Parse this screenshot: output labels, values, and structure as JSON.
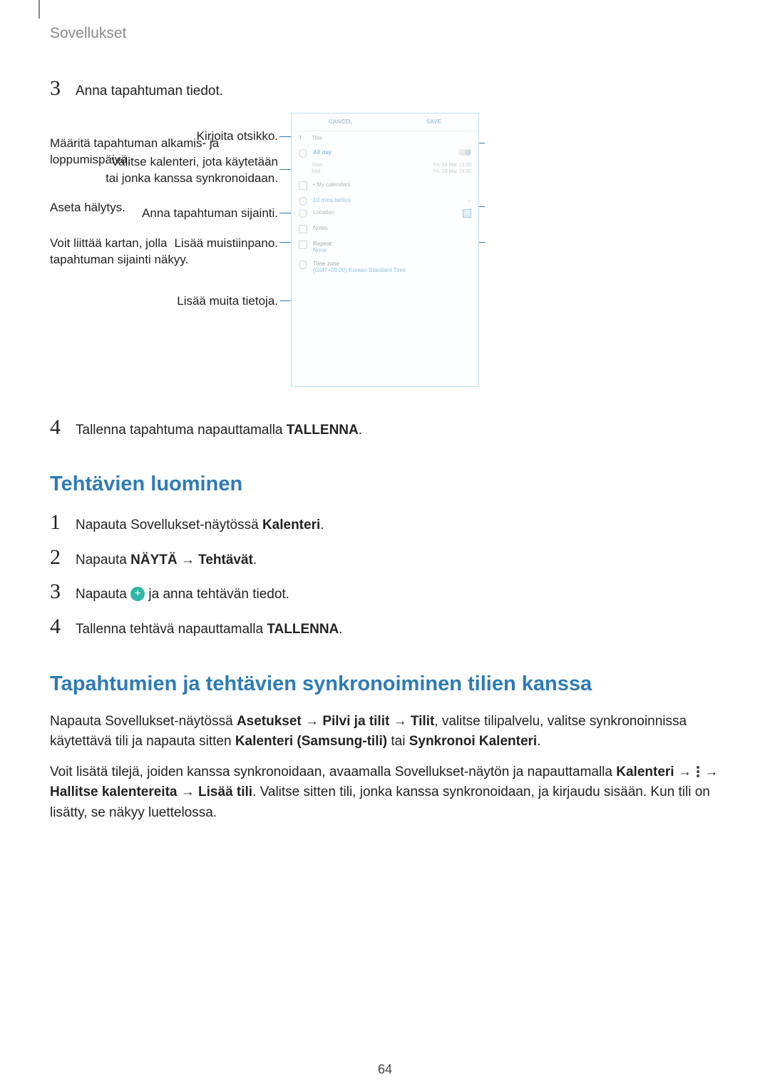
{
  "header": "Sovellukset",
  "page_number": "64",
  "step3": {
    "num": "3",
    "text": "Anna tapahtuman tiedot."
  },
  "diagram": {
    "left": {
      "title": "Kirjoita otsikko.",
      "calendar_l1": "Valitse kalenteri, jota käytetään",
      "calendar_l2": "tai jonka kanssa synkronoidaan.",
      "location": "Anna tapahtuman sijainti.",
      "note": "Lisää muistiinpano.",
      "more": "Lisää muita tietoja."
    },
    "right": {
      "dates_l1": "Määritä tapahtuman alkamis- ja",
      "dates_l2": "loppumispäivä.",
      "alarm": "Aseta hälytys.",
      "map_l1": "Voit liittää kartan, jolla",
      "map_l2": "tapahtuman sijainti näkyy."
    },
    "phone": {
      "cancel": "CANCEL",
      "save": "SAVE",
      "title_field": "Title",
      "allday": "All day",
      "start": "Start",
      "end": "End",
      "start_val": "Fri, 24 Mar  15:00",
      "end_val": "Fri, 24 Mar  16:00",
      "mycalendars": "• My calendars",
      "reminder": "10 mins before",
      "location": "Location",
      "notes": "Notes",
      "repeat": "Repeat",
      "repeat_val": "None",
      "timezone": "Time zone",
      "tz_val": "(GMT+09:00) Korean Standard Time"
    }
  },
  "step4": {
    "num": "4",
    "prefix": "Tallenna tapahtuma napauttamalla ",
    "bold": "TALLENNA",
    "suffix": "."
  },
  "tasks": {
    "title": "Tehtävien luominen",
    "s1": {
      "num": "1",
      "prefix": "Napauta Sovellukset-näytössä ",
      "bold": "Kalenteri",
      "suffix": "."
    },
    "s2": {
      "num": "2",
      "prefix": "Napauta ",
      "bold1": "NÄYTÄ",
      "arrow": " → ",
      "bold2": "Tehtävät",
      "suffix": "."
    },
    "s3": {
      "num": "3",
      "prefix": "Napauta ",
      "suffix": " ja anna tehtävän tiedot."
    },
    "s4": {
      "num": "4",
      "prefix": "Tallenna tehtävä napauttamalla ",
      "bold": "TALLENNA",
      "suffix": "."
    }
  },
  "sync": {
    "title": "Tapahtumien ja tehtävien synkronoiminen tilien kanssa",
    "p1_a": "Napauta Sovellukset-näytössä ",
    "p1_b1": "Asetukset",
    "p1_arr1": " → ",
    "p1_b2": "Pilvi ja tilit",
    "p1_arr2": " → ",
    "p1_b3": "Tilit",
    "p1_c": ", valitse tilipalvelu, valitse synkronoinnissa käytettävä tili ja napauta sitten ",
    "p1_b4": "Kalenteri (Samsung-tili)",
    "p1_d": " tai ",
    "p1_b5": "Synkronoi Kalenteri",
    "p1_e": ".",
    "p2_a": "Voit lisätä tilejä, joiden kanssa synkronoidaan, avaamalla Sovellukset-näytön ja napauttamalla ",
    "p2_b1": "Kalenteri",
    "p2_arr1": " → ",
    "p2_arr2": " → ",
    "p2_b2": "Hallitse kalentereita",
    "p2_arr3": " → ",
    "p2_b3": "Lisää tili",
    "p2_c": ". Valitse sitten tili, jonka kanssa synkronoidaan, ja kirjaudu sisään. Kun tili on lisätty, se näkyy luettelossa."
  }
}
